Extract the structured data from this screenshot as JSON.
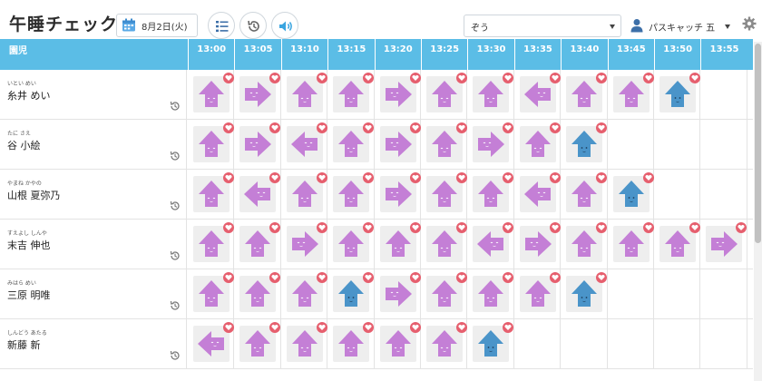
{
  "app": {
    "title": "午睡チェック",
    "date": "8月2日(火)",
    "room_select": "ぞう",
    "user_name": "パスキャッチ 五"
  },
  "colors": {
    "header_blue": "#5bbde6",
    "mark_purple": "#c47fd6",
    "mark_blue": "#4a94c9",
    "heart_red": "#e65f6e"
  },
  "grid": {
    "name_header": "園児",
    "times": [
      "13:00",
      "13:05",
      "13:10",
      "13:15",
      "13:20",
      "13:25",
      "13:30",
      "13:35",
      "13:40",
      "13:45",
      "13:50",
      "13:55"
    ],
    "rows": [
      {
        "furigana": "いとい めい",
        "name": "糸井 めい",
        "marks": [
          {
            "dir": "up",
            "color": "purple"
          },
          {
            "dir": "right",
            "color": "purple"
          },
          {
            "dir": "up",
            "color": "purple"
          },
          {
            "dir": "up",
            "color": "purple"
          },
          {
            "dir": "right",
            "color": "purple"
          },
          {
            "dir": "up",
            "color": "purple"
          },
          {
            "dir": "up",
            "color": "purple"
          },
          {
            "dir": "left",
            "color": "purple"
          },
          {
            "dir": "up",
            "color": "purple"
          },
          {
            "dir": "up",
            "color": "purple"
          },
          {
            "dir": "up",
            "color": "blue"
          }
        ]
      },
      {
        "furigana": "たに さえ",
        "name": "谷 小絵",
        "marks": [
          {
            "dir": "up",
            "color": "purple"
          },
          {
            "dir": "right",
            "color": "purple"
          },
          {
            "dir": "left",
            "color": "purple"
          },
          {
            "dir": "up",
            "color": "purple"
          },
          {
            "dir": "right",
            "color": "purple"
          },
          {
            "dir": "up",
            "color": "purple"
          },
          {
            "dir": "right",
            "color": "purple"
          },
          {
            "dir": "up",
            "color": "purple"
          },
          {
            "dir": "up",
            "color": "blue"
          }
        ]
      },
      {
        "furigana": "やまね かやの",
        "name": "山根 夏弥乃",
        "marks": [
          {
            "dir": "up",
            "color": "purple"
          },
          {
            "dir": "left",
            "color": "purple"
          },
          {
            "dir": "up",
            "color": "purple"
          },
          {
            "dir": "up",
            "color": "purple"
          },
          {
            "dir": "right",
            "color": "purple"
          },
          {
            "dir": "up",
            "color": "purple"
          },
          {
            "dir": "up",
            "color": "purple"
          },
          {
            "dir": "left",
            "color": "purple"
          },
          {
            "dir": "up",
            "color": "purple"
          },
          {
            "dir": "up",
            "color": "blue"
          }
        ]
      },
      {
        "furigana": "すえよし しんや",
        "name": "末吉 伸也",
        "marks": [
          {
            "dir": "up",
            "color": "purple"
          },
          {
            "dir": "up",
            "color": "purple"
          },
          {
            "dir": "right",
            "color": "purple"
          },
          {
            "dir": "up",
            "color": "purple"
          },
          {
            "dir": "up",
            "color": "purple"
          },
          {
            "dir": "up",
            "color": "purple"
          },
          {
            "dir": "left",
            "color": "purple"
          },
          {
            "dir": "right",
            "color": "purple"
          },
          {
            "dir": "up",
            "color": "purple"
          },
          {
            "dir": "up",
            "color": "purple"
          },
          {
            "dir": "up",
            "color": "purple"
          },
          {
            "dir": "right",
            "color": "purple"
          }
        ]
      },
      {
        "furigana": "みはら めい",
        "name": "三原 明唯",
        "marks": [
          {
            "dir": "up",
            "color": "purple"
          },
          {
            "dir": "up",
            "color": "purple"
          },
          {
            "dir": "up",
            "color": "purple"
          },
          {
            "dir": "up",
            "color": "blue"
          },
          {
            "dir": "right",
            "color": "purple"
          },
          {
            "dir": "up",
            "color": "purple"
          },
          {
            "dir": "up",
            "color": "purple"
          },
          {
            "dir": "up",
            "color": "purple"
          },
          {
            "dir": "up",
            "color": "blue"
          }
        ]
      },
      {
        "furigana": "しんどう あたる",
        "name": "新藤 新",
        "marks": [
          {
            "dir": "left",
            "color": "purple"
          },
          {
            "dir": "up",
            "color": "purple"
          },
          {
            "dir": "up",
            "color": "purple"
          },
          {
            "dir": "up",
            "color": "purple"
          },
          {
            "dir": "up",
            "color": "purple"
          },
          {
            "dir": "up",
            "color": "purple"
          },
          {
            "dir": "up",
            "color": "blue"
          }
        ]
      }
    ]
  }
}
